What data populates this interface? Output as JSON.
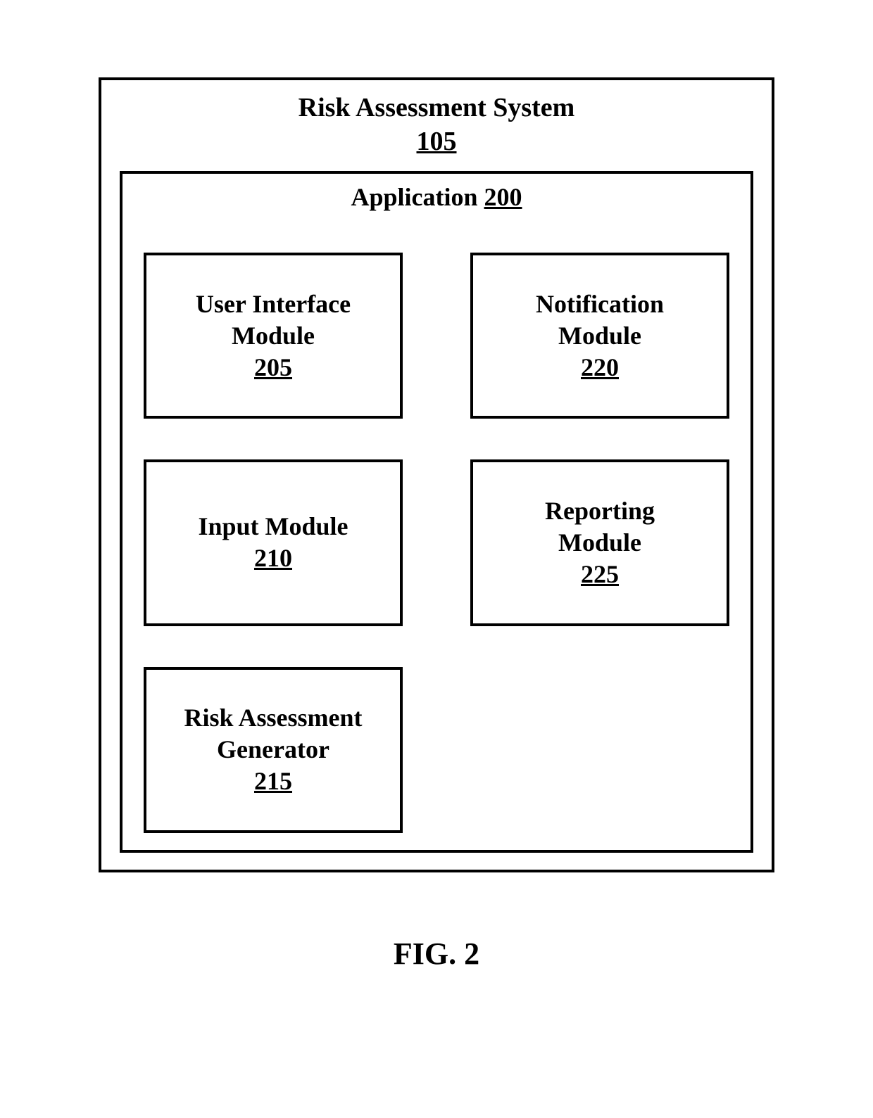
{
  "system": {
    "title": "Risk Assessment System",
    "ref": "105"
  },
  "application": {
    "title": "Application",
    "ref": "200"
  },
  "modules": {
    "ui": {
      "line1": "User Interface",
      "line2": "Module",
      "ref": "205"
    },
    "notify": {
      "line1": "Notification",
      "line2": "Module",
      "ref": "220"
    },
    "input": {
      "line1": "Input Module",
      "line2": "",
      "ref": "210"
    },
    "report": {
      "line1": "Reporting",
      "line2": "Module",
      "ref": "225"
    },
    "gen": {
      "line1": "Risk Assessment",
      "line2": "Generator",
      "ref": "215"
    }
  },
  "caption": "FIG. 2"
}
